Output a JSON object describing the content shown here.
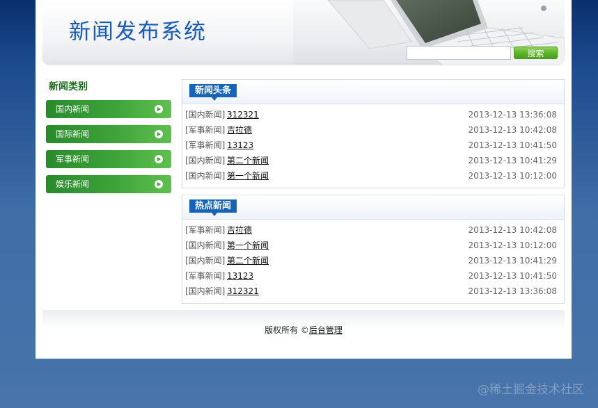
{
  "header": {
    "title": "新闻发布系统",
    "search_placeholder": "",
    "search_button": "搜索"
  },
  "sidebar": {
    "title": "新闻类别",
    "items": [
      {
        "label": "国内新闻"
      },
      {
        "label": "国际新闻"
      },
      {
        "label": "军事新闻"
      },
      {
        "label": "娱乐新闻"
      }
    ]
  },
  "headlines": {
    "title": "新闻头条",
    "rows": [
      {
        "category": "[国内新闻]",
        "title": "312321",
        "time": "2013-12-13 13:36:08"
      },
      {
        "category": "[军事新闻]",
        "title": "吉拉德",
        "time": "2013-12-13 10:42:08"
      },
      {
        "category": "[军事新闻]",
        "title": "13123",
        "time": "2013-12-13 10:41:50"
      },
      {
        "category": "[国内新闻]",
        "title": "第二个新闻",
        "time": "2013-12-13 10:41:29"
      },
      {
        "category": "[国内新闻]",
        "title": "第一个新闻",
        "time": "2013-12-13 10:12:00"
      }
    ]
  },
  "hot": {
    "title": "热点新闻",
    "rows": [
      {
        "category": "[军事新闻]",
        "title": "吉拉德",
        "time": "2013-12-13 10:42:08"
      },
      {
        "category": "[国内新闻]",
        "title": "第一个新闻",
        "time": "2013-12-13 10:12:00"
      },
      {
        "category": "[国内新闻]",
        "title": "第二个新闻",
        "time": "2013-12-13 10:41:29"
      },
      {
        "category": "[军事新闻]",
        "title": "13123",
        "time": "2013-12-13 10:41:50"
      },
      {
        "category": "[国内新闻]",
        "title": "312321",
        "time": "2013-12-13 13:36:08"
      }
    ]
  },
  "footer": {
    "copyright": "版权所有 ©",
    "admin_link": "后台管理"
  },
  "watermark": "@稀土掘金技术社区"
}
